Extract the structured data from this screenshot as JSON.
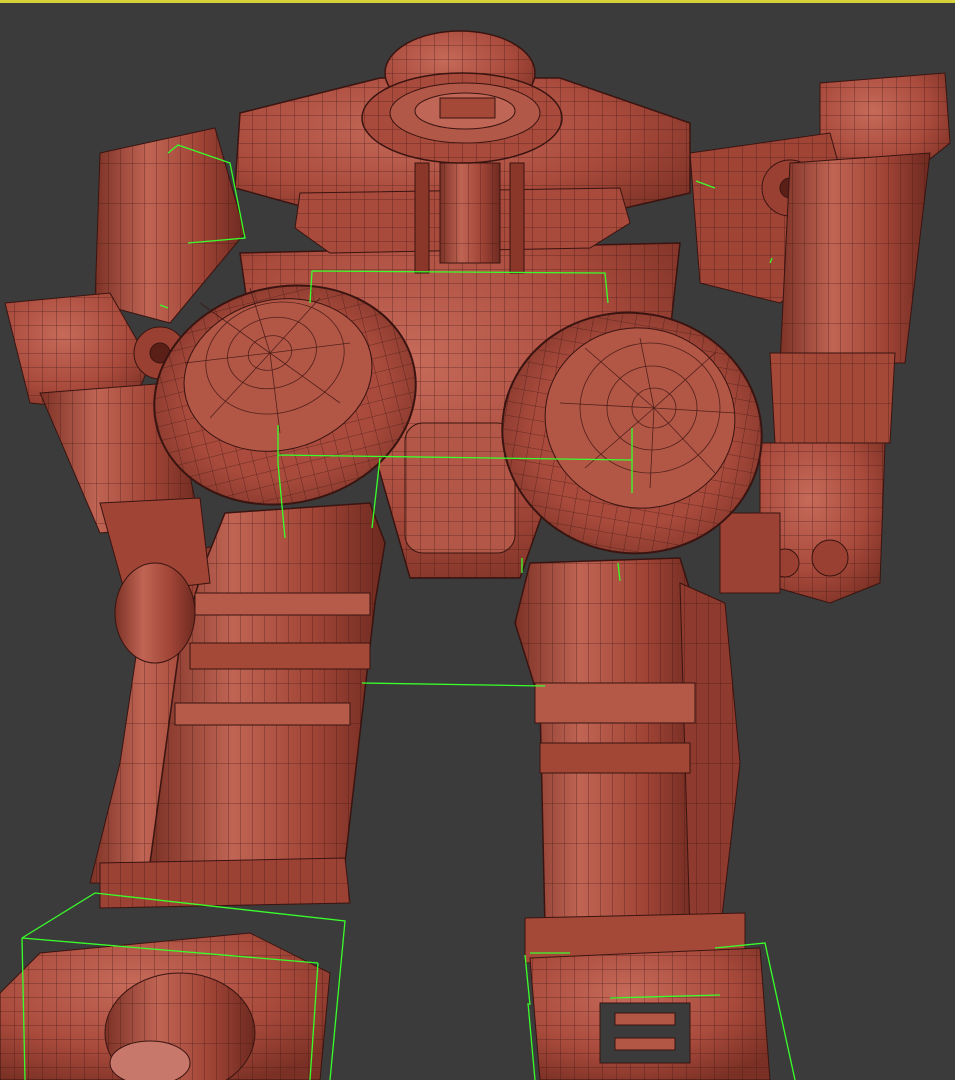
{
  "viewport": {
    "active": true,
    "background": "#3b3b3b",
    "active_border_color": "#d6d23a"
  },
  "model": {
    "shading": "wireframe-over-shaded",
    "mesh_color": "#a84a3c",
    "mesh_highlight": "#c26656",
    "wire_color": "#3a1410",
    "bbox_color": "#39ff2a"
  }
}
